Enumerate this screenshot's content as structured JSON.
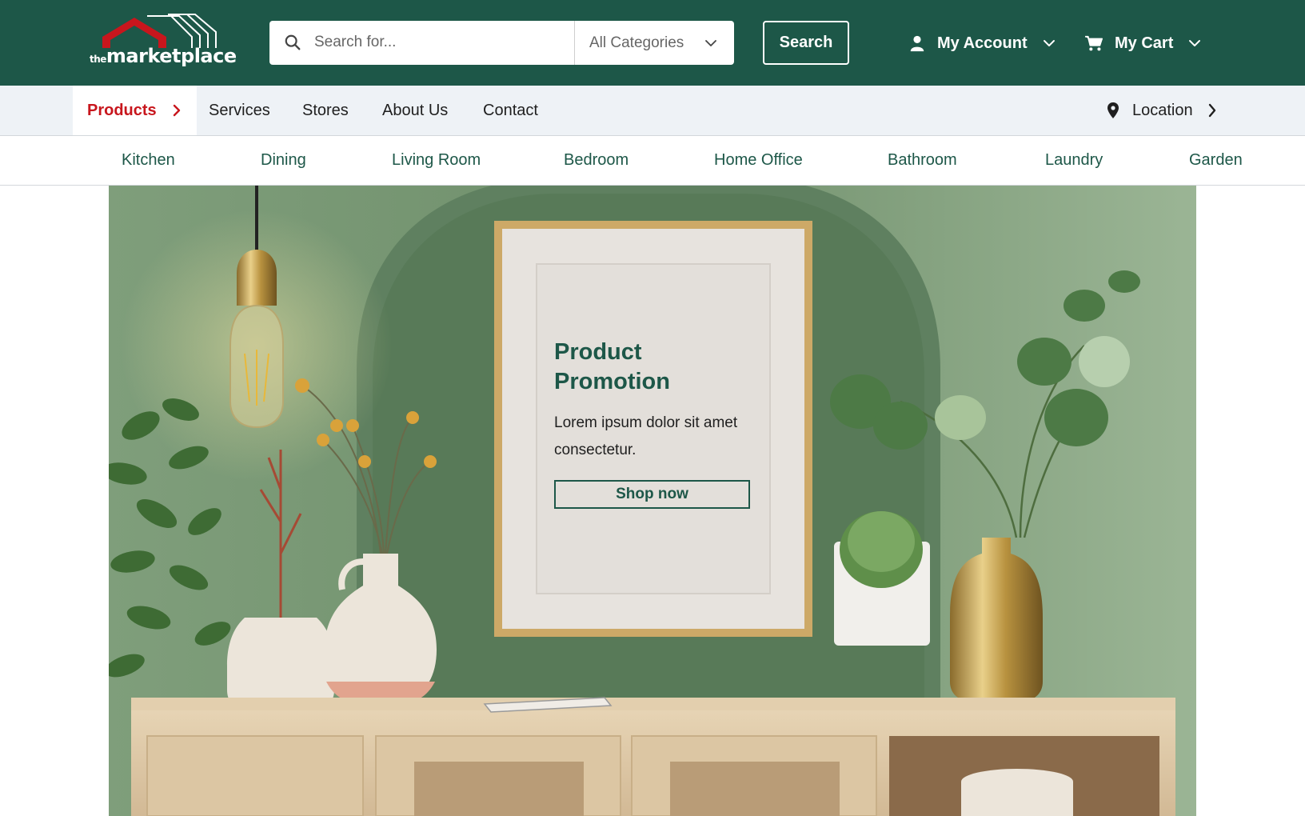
{
  "brand": {
    "logo_prefix": "the",
    "logo_name": "marketplace",
    "colors": {
      "primary": "#1d5748",
      "accent": "#c8161d",
      "nav_bg": "#eef2f6"
    }
  },
  "header": {
    "search": {
      "placeholder": "Search for...",
      "icon": "search-icon",
      "category_selected": "All Categories"
    },
    "search_button": "Search",
    "account": {
      "label": "My Account",
      "icon": "user-icon"
    },
    "cart": {
      "label": "My Cart",
      "icon": "cart-icon"
    }
  },
  "nav": {
    "items": [
      {
        "label": "Products",
        "active": true
      },
      {
        "label": "Services"
      },
      {
        "label": "Stores"
      },
      {
        "label": "About Us"
      },
      {
        "label": "Contact"
      }
    ],
    "location": {
      "label": "Location",
      "icon": "map-pin-icon"
    }
  },
  "categories": [
    "Kitchen",
    "Dining",
    "Living Room",
    "Bedroom",
    "Home Office",
    "Bathroom",
    "Laundry",
    "Garden"
  ],
  "hero": {
    "title": "Product Promotion",
    "text": "Lorem ipsum dolor sit amet consectetur.",
    "cta": "Shop now"
  }
}
